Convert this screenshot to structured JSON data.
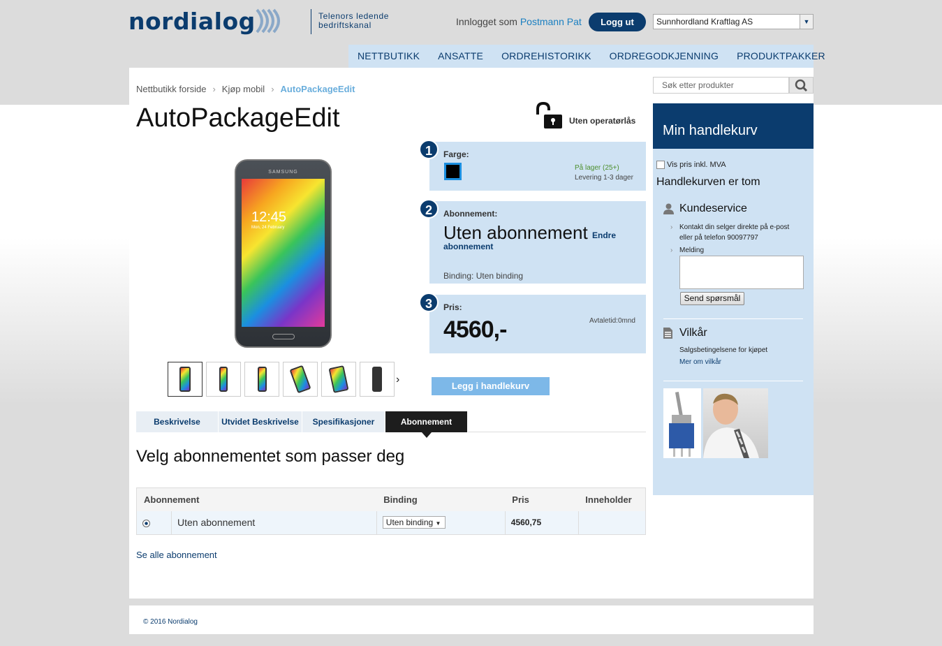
{
  "header": {
    "logo": "nordialog",
    "tagline_line1": "Telenors ledende",
    "tagline_line2": "bedriftskanal",
    "logged_in_prefix": "Innlogget som",
    "user_name": "Postmann Pat",
    "logout_label": "Logg ut",
    "company_selected": "Sunnhordland Kraftlag AS"
  },
  "nav": {
    "items": [
      "NETTBUTIKK",
      "ANSATTE",
      "ORDREHISTORIKK",
      "ORDREGODKJENNING",
      "PRODUKTPAKKER"
    ]
  },
  "breadcrumb": {
    "items": [
      "Nettbutikk forside",
      "Kjøp mobil",
      "AutoPackageEdit"
    ]
  },
  "product": {
    "title": "AutoPackageEdit",
    "lock_label": "Uten operatørlås",
    "phone_brand": "SAMSUNG",
    "phone_time": "12:45",
    "phone_date": "Mon, 24 February"
  },
  "steps": {
    "step1": {
      "number": "1",
      "label": "Farge:",
      "color": "#000000",
      "stock": "På lager (25+)",
      "delivery": "Levering 1-3 dager"
    },
    "step2": {
      "number": "2",
      "label": "Abonnement:",
      "subscription": "Uten abonnement",
      "change_link_1": "Endre",
      "change_link_2": "abonnement",
      "binding": "Binding: Uten binding"
    },
    "step3": {
      "number": "3",
      "label": "Pris:",
      "price": "4560,-",
      "term": "Avtaletid:0mnd"
    }
  },
  "add_to_cart_label": "Legg i handlekurv",
  "tabs": [
    "Beskrivelse",
    "Utvidet Beskrivelse",
    "Spesifikasjoner",
    "Abonnement"
  ],
  "section_title": "Velg abonnementet som passer deg",
  "table": {
    "headers": [
      "Abonnement",
      "Binding",
      "Pris",
      "Inneholder"
    ],
    "rows": [
      {
        "name": "Uten abonnement",
        "binding": "Uten binding",
        "price": "4560,75",
        "contains": ""
      }
    ]
  },
  "see_all_label": "Se alle abonnement",
  "sidebar": {
    "search_placeholder": "Søk etter produkter",
    "cart_title": "Min handlekurv",
    "vat_label": "Vis pris inkl. MVA",
    "cart_empty": "Handlekurven er tom",
    "ks_title": "Kundeservice",
    "ks_line1": "Kontakt din selger direkte på e-post",
    "ks_line2": "eller på telefon 90097797",
    "ks_message": "Melding",
    "send_label": "Send spørsmål",
    "vk_title": "Vilkår",
    "vk_line": "Salgsbetingelsene for kjøpet",
    "vk_link": "Mer om vilkår"
  },
  "footer": "© 2016 Nordialog",
  "colors": {
    "brand_navy": "#0b3c6e",
    "light_blue_panel": "#cfe2f3",
    "link_light": "#1a7fc1",
    "cart_button": "#7db8e8"
  }
}
